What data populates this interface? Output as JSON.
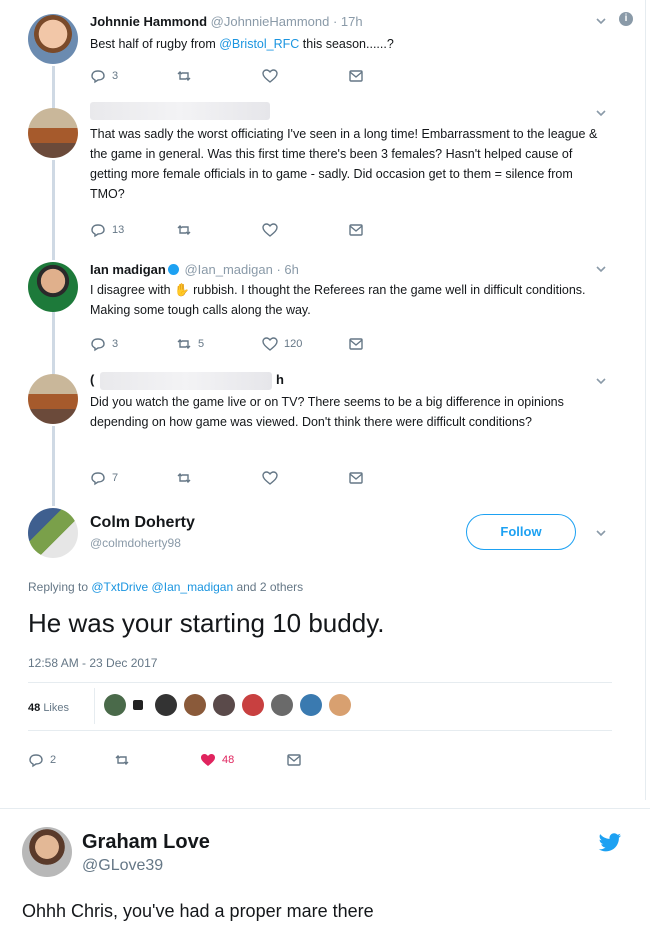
{
  "tweets": {
    "johnnie": {
      "name": "Johnnie Hammond",
      "handle": "@JohnnieHammond",
      "time": "· 17h",
      "text_prefix": "Best half of rugby from ",
      "mention": "@Bristol_RFC",
      "text_suffix": " this season......?",
      "replies": "3"
    },
    "anon1": {
      "text": "That was sadly the worst officiating I've seen in a long time! Embarrassment to the league & the game in general. Was this first time there's been 3 females? Hasn't helped cause of getting more female officials in to game - sadly. Did occasion get to them = silence from TMO?",
      "replies": "13"
    },
    "ian": {
      "name": "Ian madigan",
      "handle": "@Ian_madigan",
      "time": "· 6h",
      "text_prefix": "I disagree with ",
      "text_suffix": " rubbish. I thought the Referees ran the game well in difficult conditions. Making some tough calls along the way.",
      "replies": "3",
      "retweets": "5",
      "likes": "120"
    },
    "anon2": {
      "name_start": "(",
      "name_end": "h",
      "text": "Did you watch the game live or on TV? There seems to be a big difference in opinions depending on how game was viewed. Don't think there were difficult conditions?",
      "replies": "7"
    },
    "colm": {
      "name": "Colm Doherty",
      "handle": "@colmdoherty98",
      "follow_label": "Follow",
      "replying_prefix": "Replying to ",
      "replying_mentions": "@TxtDrive @Ian_madigan",
      "replying_suffix": " and 2 others",
      "text": "He was your starting 10 buddy.",
      "timestamp": "12:58 AM - 23 Dec 2017",
      "likes_count": "48",
      "likes_label": "Likes",
      "replies": "2",
      "likes": "48"
    }
  },
  "graham": {
    "name": "Graham Love",
    "handle": "@GLove39",
    "text": "Ohhh Chris, you've had a proper mare there"
  },
  "colors": {
    "accent": "#1da1f2",
    "like": "#e0245e",
    "muted": "#657786"
  }
}
